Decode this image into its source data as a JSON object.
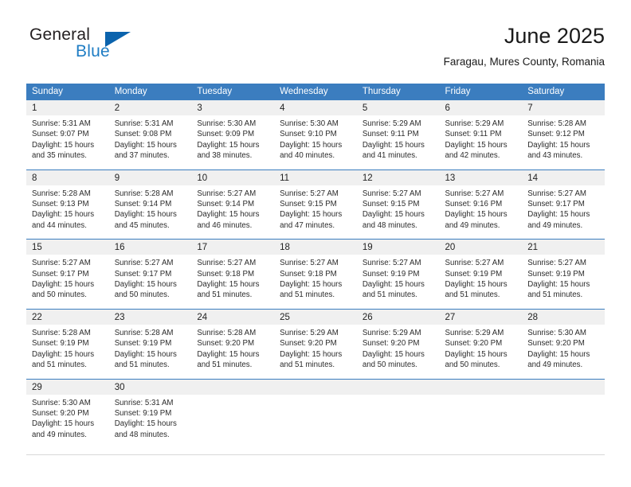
{
  "brand": {
    "name_top": "General",
    "name_bottom": "Blue",
    "accent_color": "#1f7dc4",
    "triangle_color": "#0b63ad"
  },
  "header": {
    "title": "June 2025",
    "subtitle": "Faragau, Mures County, Romania"
  },
  "theme": {
    "header_row_bg": "#3b7dbf",
    "daynum_bg": "#f0f0f0",
    "cell_bg": "#ffffff",
    "text_color": "#222222"
  },
  "weekdays": [
    "Sunday",
    "Monday",
    "Tuesday",
    "Wednesday",
    "Thursday",
    "Friday",
    "Saturday"
  ],
  "weeks": [
    [
      {
        "day": "1",
        "sunrise": "Sunrise: 5:31 AM",
        "sunset": "Sunset: 9:07 PM",
        "daylight1": "Daylight: 15 hours",
        "daylight2": "and 35 minutes."
      },
      {
        "day": "2",
        "sunrise": "Sunrise: 5:31 AM",
        "sunset": "Sunset: 9:08 PM",
        "daylight1": "Daylight: 15 hours",
        "daylight2": "and 37 minutes."
      },
      {
        "day": "3",
        "sunrise": "Sunrise: 5:30 AM",
        "sunset": "Sunset: 9:09 PM",
        "daylight1": "Daylight: 15 hours",
        "daylight2": "and 38 minutes."
      },
      {
        "day": "4",
        "sunrise": "Sunrise: 5:30 AM",
        "sunset": "Sunset: 9:10 PM",
        "daylight1": "Daylight: 15 hours",
        "daylight2": "and 40 minutes."
      },
      {
        "day": "5",
        "sunrise": "Sunrise: 5:29 AM",
        "sunset": "Sunset: 9:11 PM",
        "daylight1": "Daylight: 15 hours",
        "daylight2": "and 41 minutes."
      },
      {
        "day": "6",
        "sunrise": "Sunrise: 5:29 AM",
        "sunset": "Sunset: 9:11 PM",
        "daylight1": "Daylight: 15 hours",
        "daylight2": "and 42 minutes."
      },
      {
        "day": "7",
        "sunrise": "Sunrise: 5:28 AM",
        "sunset": "Sunset: 9:12 PM",
        "daylight1": "Daylight: 15 hours",
        "daylight2": "and 43 minutes."
      }
    ],
    [
      {
        "day": "8",
        "sunrise": "Sunrise: 5:28 AM",
        "sunset": "Sunset: 9:13 PM",
        "daylight1": "Daylight: 15 hours",
        "daylight2": "and 44 minutes."
      },
      {
        "day": "9",
        "sunrise": "Sunrise: 5:28 AM",
        "sunset": "Sunset: 9:14 PM",
        "daylight1": "Daylight: 15 hours",
        "daylight2": "and 45 minutes."
      },
      {
        "day": "10",
        "sunrise": "Sunrise: 5:27 AM",
        "sunset": "Sunset: 9:14 PM",
        "daylight1": "Daylight: 15 hours",
        "daylight2": "and 46 minutes."
      },
      {
        "day": "11",
        "sunrise": "Sunrise: 5:27 AM",
        "sunset": "Sunset: 9:15 PM",
        "daylight1": "Daylight: 15 hours",
        "daylight2": "and 47 minutes."
      },
      {
        "day": "12",
        "sunrise": "Sunrise: 5:27 AM",
        "sunset": "Sunset: 9:15 PM",
        "daylight1": "Daylight: 15 hours",
        "daylight2": "and 48 minutes."
      },
      {
        "day": "13",
        "sunrise": "Sunrise: 5:27 AM",
        "sunset": "Sunset: 9:16 PM",
        "daylight1": "Daylight: 15 hours",
        "daylight2": "and 49 minutes."
      },
      {
        "day": "14",
        "sunrise": "Sunrise: 5:27 AM",
        "sunset": "Sunset: 9:17 PM",
        "daylight1": "Daylight: 15 hours",
        "daylight2": "and 49 minutes."
      }
    ],
    [
      {
        "day": "15",
        "sunrise": "Sunrise: 5:27 AM",
        "sunset": "Sunset: 9:17 PM",
        "daylight1": "Daylight: 15 hours",
        "daylight2": "and 50 minutes."
      },
      {
        "day": "16",
        "sunrise": "Sunrise: 5:27 AM",
        "sunset": "Sunset: 9:17 PM",
        "daylight1": "Daylight: 15 hours",
        "daylight2": "and 50 minutes."
      },
      {
        "day": "17",
        "sunrise": "Sunrise: 5:27 AM",
        "sunset": "Sunset: 9:18 PM",
        "daylight1": "Daylight: 15 hours",
        "daylight2": "and 51 minutes."
      },
      {
        "day": "18",
        "sunrise": "Sunrise: 5:27 AM",
        "sunset": "Sunset: 9:18 PM",
        "daylight1": "Daylight: 15 hours",
        "daylight2": "and 51 minutes."
      },
      {
        "day": "19",
        "sunrise": "Sunrise: 5:27 AM",
        "sunset": "Sunset: 9:19 PM",
        "daylight1": "Daylight: 15 hours",
        "daylight2": "and 51 minutes."
      },
      {
        "day": "20",
        "sunrise": "Sunrise: 5:27 AM",
        "sunset": "Sunset: 9:19 PM",
        "daylight1": "Daylight: 15 hours",
        "daylight2": "and 51 minutes."
      },
      {
        "day": "21",
        "sunrise": "Sunrise: 5:27 AM",
        "sunset": "Sunset: 9:19 PM",
        "daylight1": "Daylight: 15 hours",
        "daylight2": "and 51 minutes."
      }
    ],
    [
      {
        "day": "22",
        "sunrise": "Sunrise: 5:28 AM",
        "sunset": "Sunset: 9:19 PM",
        "daylight1": "Daylight: 15 hours",
        "daylight2": "and 51 minutes."
      },
      {
        "day": "23",
        "sunrise": "Sunrise: 5:28 AM",
        "sunset": "Sunset: 9:19 PM",
        "daylight1": "Daylight: 15 hours",
        "daylight2": "and 51 minutes."
      },
      {
        "day": "24",
        "sunrise": "Sunrise: 5:28 AM",
        "sunset": "Sunset: 9:20 PM",
        "daylight1": "Daylight: 15 hours",
        "daylight2": "and 51 minutes."
      },
      {
        "day": "25",
        "sunrise": "Sunrise: 5:29 AM",
        "sunset": "Sunset: 9:20 PM",
        "daylight1": "Daylight: 15 hours",
        "daylight2": "and 51 minutes."
      },
      {
        "day": "26",
        "sunrise": "Sunrise: 5:29 AM",
        "sunset": "Sunset: 9:20 PM",
        "daylight1": "Daylight: 15 hours",
        "daylight2": "and 50 minutes."
      },
      {
        "day": "27",
        "sunrise": "Sunrise: 5:29 AM",
        "sunset": "Sunset: 9:20 PM",
        "daylight1": "Daylight: 15 hours",
        "daylight2": "and 50 minutes."
      },
      {
        "day": "28",
        "sunrise": "Sunrise: 5:30 AM",
        "sunset": "Sunset: 9:20 PM",
        "daylight1": "Daylight: 15 hours",
        "daylight2": "and 49 minutes."
      }
    ],
    [
      {
        "day": "29",
        "sunrise": "Sunrise: 5:30 AM",
        "sunset": "Sunset: 9:20 PM",
        "daylight1": "Daylight: 15 hours",
        "daylight2": "and 49 minutes."
      },
      {
        "day": "30",
        "sunrise": "Sunrise: 5:31 AM",
        "sunset": "Sunset: 9:19 PM",
        "daylight1": "Daylight: 15 hours",
        "daylight2": "and 48 minutes."
      },
      {
        "day": "",
        "sunrise": "",
        "sunset": "",
        "daylight1": "",
        "daylight2": ""
      },
      {
        "day": "",
        "sunrise": "",
        "sunset": "",
        "daylight1": "",
        "daylight2": ""
      },
      {
        "day": "",
        "sunrise": "",
        "sunset": "",
        "daylight1": "",
        "daylight2": ""
      },
      {
        "day": "",
        "sunrise": "",
        "sunset": "",
        "daylight1": "",
        "daylight2": ""
      },
      {
        "day": "",
        "sunrise": "",
        "sunset": "",
        "daylight1": "",
        "daylight2": ""
      }
    ]
  ]
}
